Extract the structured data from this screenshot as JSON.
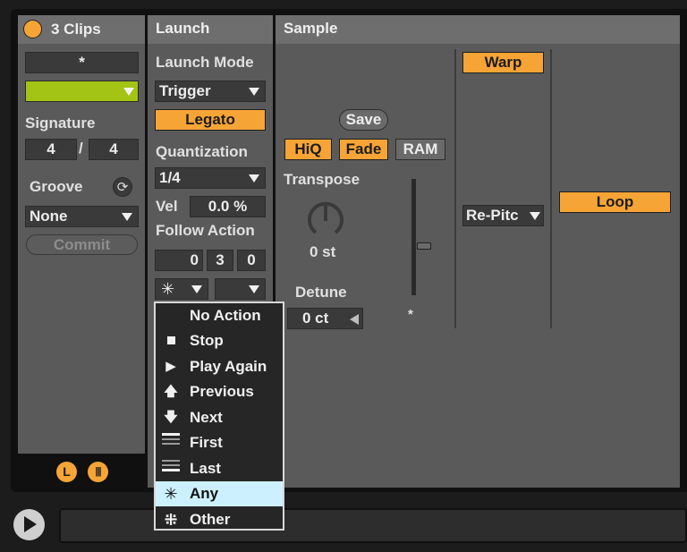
{
  "clip": {
    "header_title": "3 Clips",
    "name_value": "*",
    "signature_label": "Signature",
    "sig_numerator": "4",
    "sig_separator": "/",
    "sig_denominator": "4",
    "groove_label": "Groove",
    "groove_value": "None",
    "commit_label": "Commit",
    "footer_l": "L",
    "footer_w": "|||",
    "clip_color": "#a3c414",
    "accent": "#f7a436"
  },
  "launch": {
    "header_title": "Launch",
    "launch_mode_label": "Launch Mode",
    "launch_mode_value": "Trigger",
    "legato_label": "Legato",
    "quantization_label": "Quantization",
    "quantization_value": "1/4",
    "vel_label": "Vel",
    "vel_value": "0.0 %",
    "follow_action_label": "Follow Action",
    "follow_time": [
      "0",
      "3",
      "0"
    ],
    "follow_action_a_value": "✳",
    "follow_action_b_value": ""
  },
  "sample": {
    "header_title": "Sample",
    "warp_label": "Warp",
    "save_label": "Save",
    "hiq_label": "HiQ",
    "fade_label": "Fade",
    "ram_label": "RAM",
    "transpose_label": "Transpose",
    "transpose_value": "0 st",
    "detune_label": "Detune",
    "detune_value": "0 ct",
    "gain_value": "*",
    "warp_mode_value": "Re-Pitc",
    "loop_label": "Loop"
  },
  "follow_menu": {
    "items": [
      {
        "label": "No Action",
        "icon": ""
      },
      {
        "label": "Stop",
        "icon": "stop-icon"
      },
      {
        "label": "Play Again",
        "icon": "play-icon"
      },
      {
        "label": "Previous",
        "icon": "arrow-up-icon"
      },
      {
        "label": "Next",
        "icon": "arrow-down-icon"
      },
      {
        "label": "First",
        "icon": "first-icon"
      },
      {
        "label": "Last",
        "icon": "last-icon"
      },
      {
        "label": "Any",
        "icon": "any-icon"
      },
      {
        "label": "Other",
        "icon": "other-icon"
      }
    ],
    "selected": "Any"
  }
}
